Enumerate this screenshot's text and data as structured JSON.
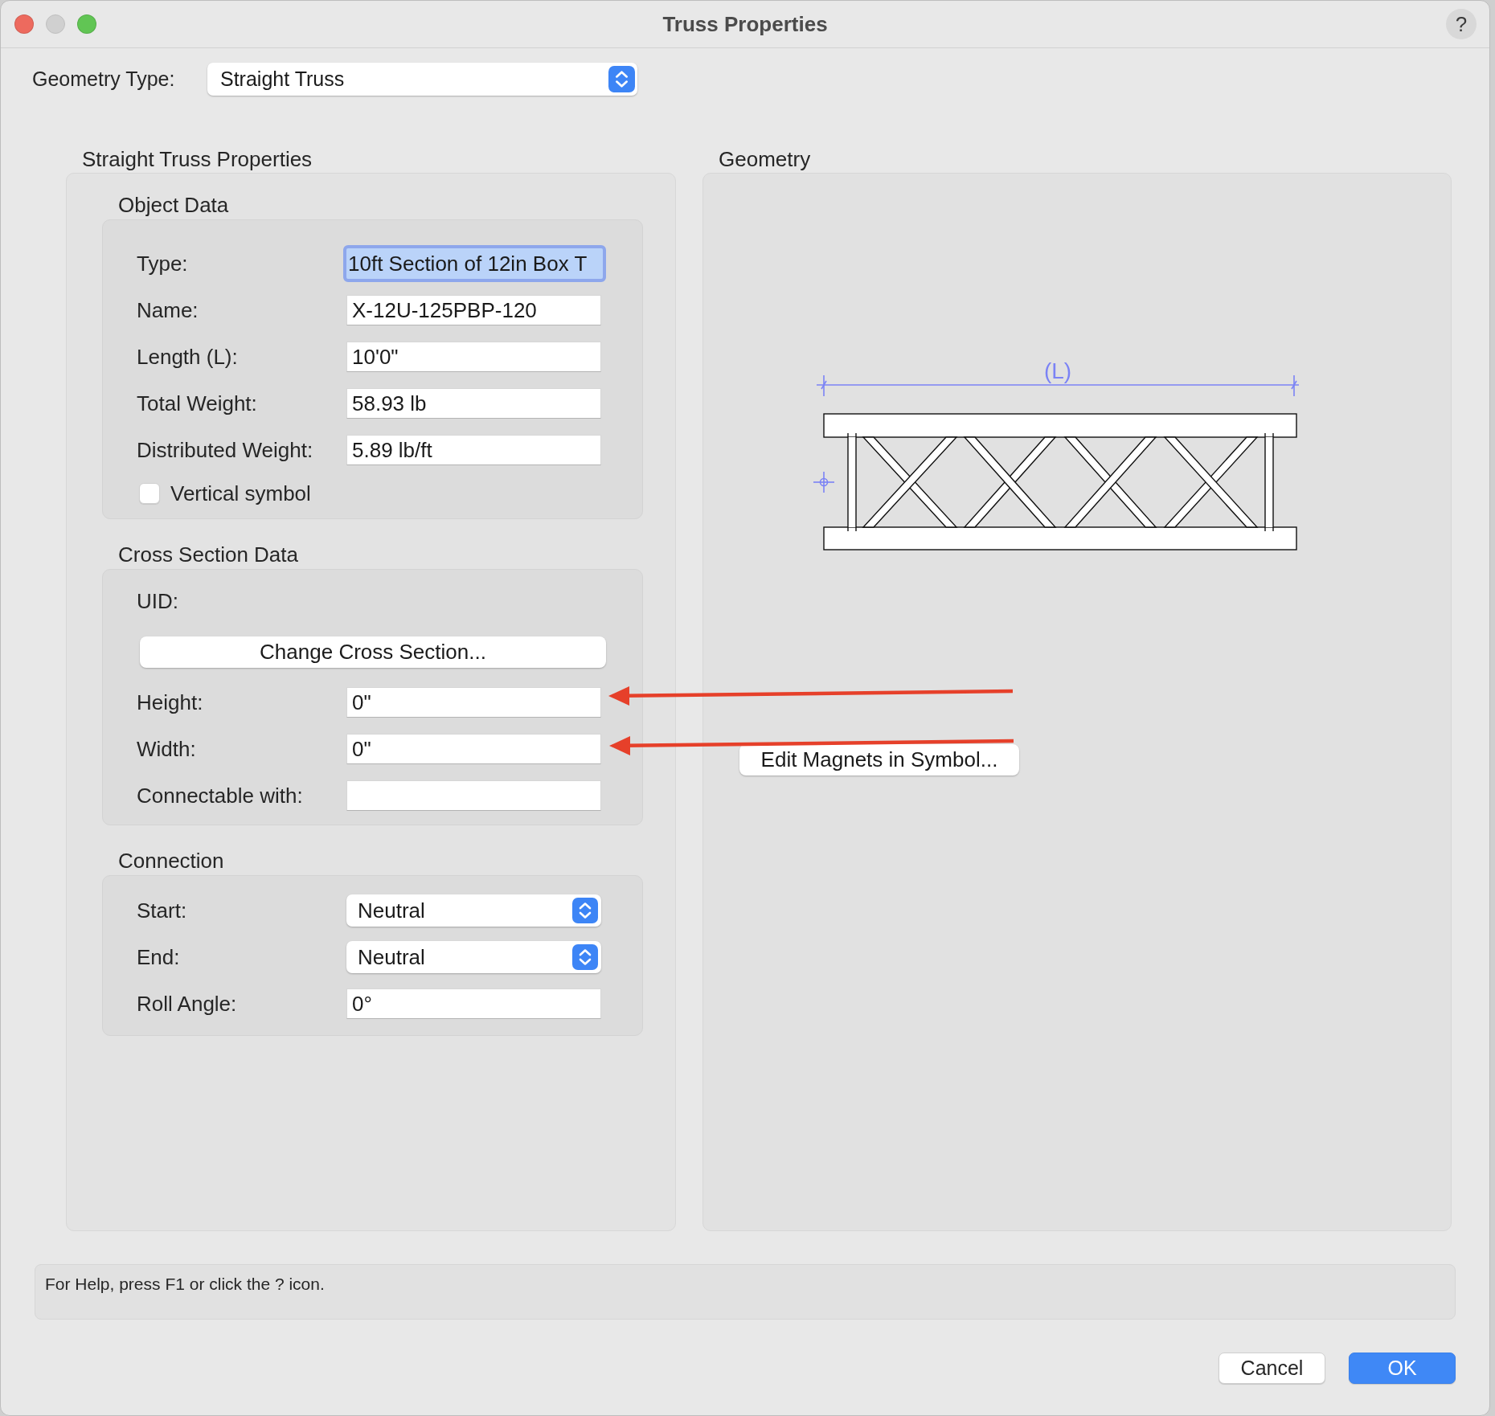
{
  "window": {
    "title": "Truss Properties",
    "controls": [
      {
        "kind": "close",
        "disabled": false
      },
      {
        "kind": "minimize",
        "disabled": true
      },
      {
        "kind": "zoom",
        "disabled": false
      }
    ],
    "help_button": "?"
  },
  "geometry_type": {
    "label": "Geometry Type:",
    "value": "Straight Truss"
  },
  "properties_panel": {
    "title": "Straight Truss Properties",
    "groups": [
      {
        "title": "Object Data",
        "rows": [
          {
            "kind": "field",
            "label": "Type:",
            "value": "10ft Section of 12in Box T",
            "focused": true
          },
          {
            "kind": "field",
            "label": "Name:",
            "value": "X-12U-125PBP-120",
            "focused": false
          },
          {
            "kind": "field",
            "label": "Length (L):",
            "value": "10'0\"",
            "focused": false
          },
          {
            "kind": "field",
            "label": "Total Weight:",
            "value": "58.93 lb",
            "focused": false
          },
          {
            "kind": "field",
            "label": "Distributed Weight:",
            "value": "5.89 lb/ft",
            "focused": false
          },
          {
            "kind": "checkbox",
            "label": "Vertical symbol",
            "checked": false
          }
        ]
      },
      {
        "title": "Cross Section Data",
        "rows": [
          {
            "kind": "label",
            "label": "UID:"
          },
          {
            "kind": "button",
            "label": "Change Cross Section..."
          },
          {
            "kind": "field",
            "label": "Height:",
            "value": "0\"",
            "focused": false
          },
          {
            "kind": "field",
            "label": "Width:",
            "value": "0\"",
            "focused": false
          },
          {
            "kind": "field",
            "label": "Connectable with:",
            "focused": false
          }
        ]
      },
      {
        "title": "Connection",
        "rows": [
          {
            "kind": "select",
            "label": "Start:",
            "value": "Neutral"
          },
          {
            "kind": "select",
            "label": "End:",
            "value": "Neutral"
          },
          {
            "kind": "field",
            "label": "Roll Angle:",
            "value": "0°",
            "focused": false
          }
        ]
      }
    ]
  },
  "geometry_panel": {
    "title": "Geometry",
    "dimension_label": "(L)",
    "button": "Edit Magnets in Symbol..."
  },
  "status_bar": {
    "text": "For Help, press F1 or click the ? icon."
  },
  "buttons": [
    {
      "label": "Cancel",
      "kind": "secondary"
    },
    {
      "label": "OK",
      "kind": "default"
    }
  ]
}
